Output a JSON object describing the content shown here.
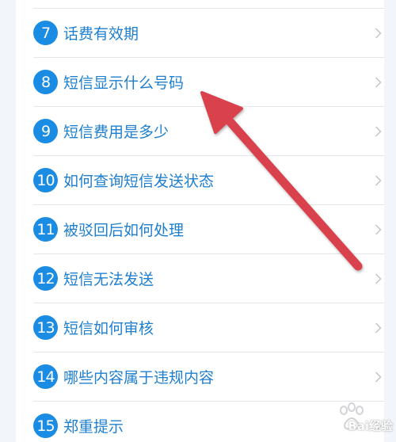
{
  "items": [
    {
      "num": "7",
      "label": "话费有效期"
    },
    {
      "num": "8",
      "label": "短信显示什么号码"
    },
    {
      "num": "9",
      "label": "短信费用是多少"
    },
    {
      "num": "10",
      "label": "如何查询短信发送状态"
    },
    {
      "num": "11",
      "label": "被驳回后如何处理"
    },
    {
      "num": "12",
      "label": "短信无法发送"
    },
    {
      "num": "13",
      "label": "短信如何审核"
    },
    {
      "num": "14",
      "label": "哪些内容属于违规内容"
    },
    {
      "num": "15",
      "label": "郑重提示"
    }
  ],
  "watermark": {
    "text": "Bai经验"
  },
  "colors": {
    "badge": "#1a8ce3",
    "label": "#1f7fcf",
    "arrow": "#d9434e"
  },
  "icons": {
    "row_chevron": "chevron-right-icon",
    "annotation": "red-arrow-annotation"
  }
}
